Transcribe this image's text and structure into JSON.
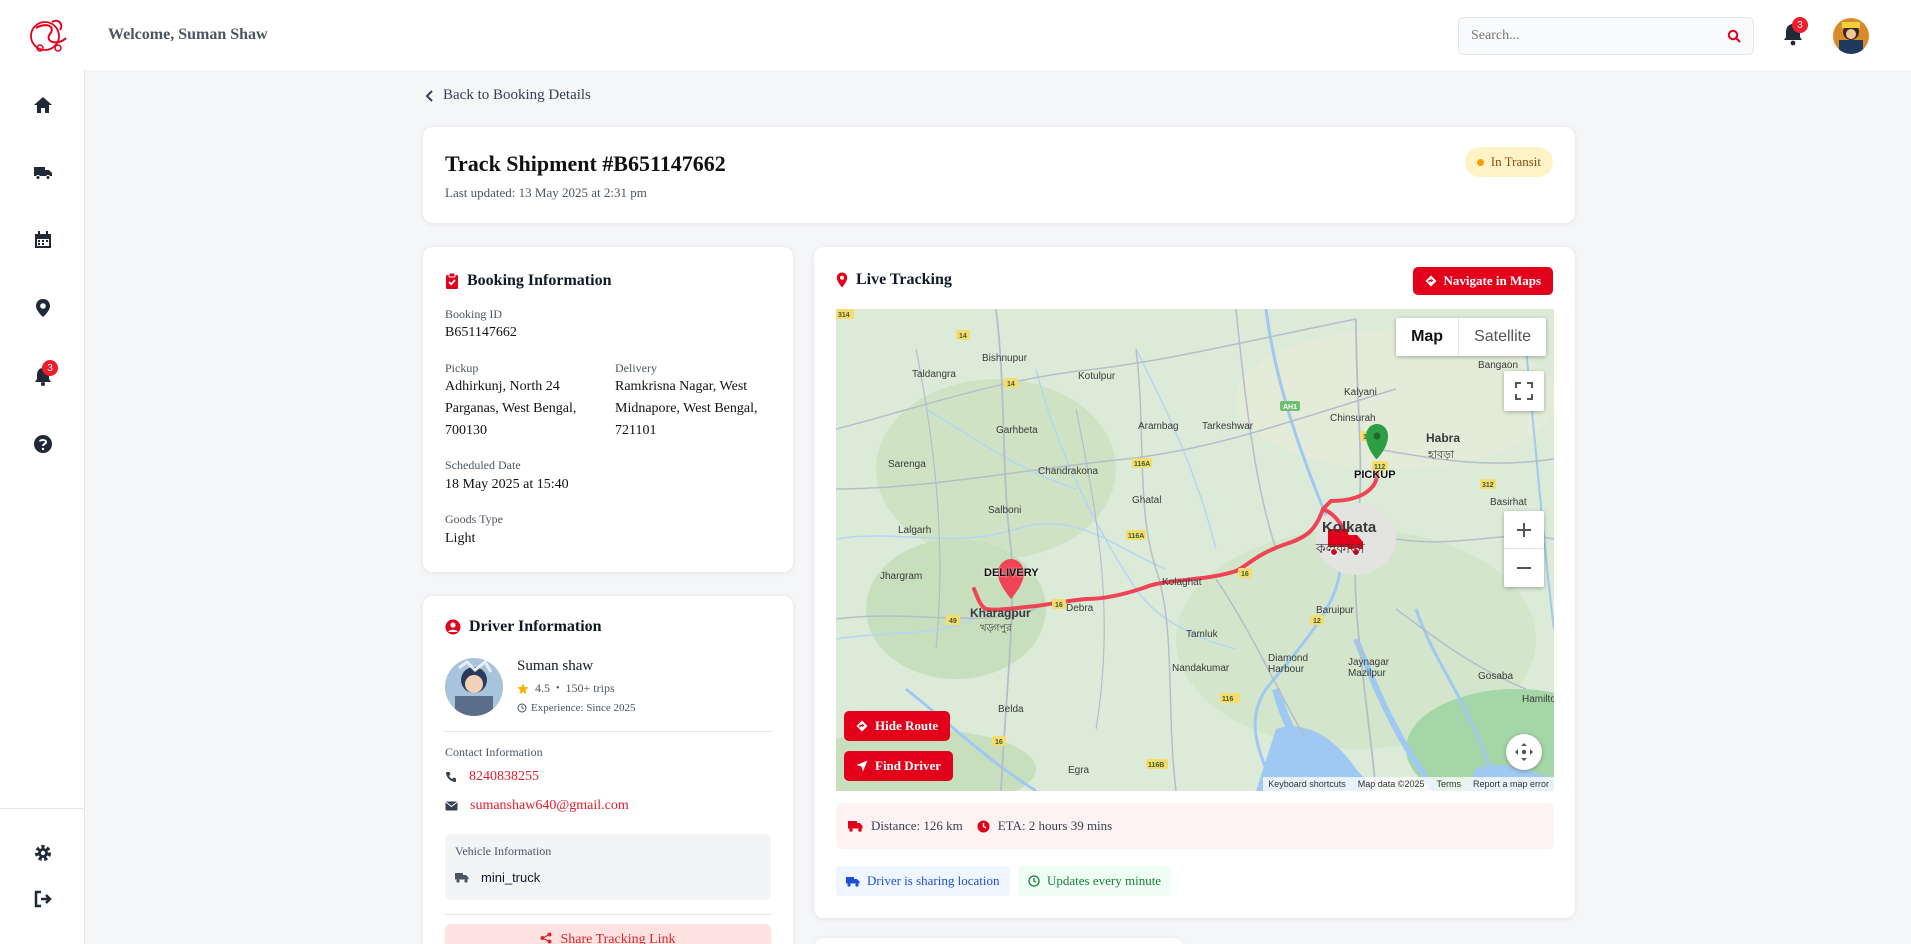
{
  "header": {
    "welcome": "Welcome, Suman Shaw",
    "search_placeholder": "Search...",
    "notification_count": "3"
  },
  "sidebar": {
    "items": [
      {
        "icon": "home-icon"
      },
      {
        "icon": "truck-icon"
      },
      {
        "icon": "calendar-icon"
      },
      {
        "icon": "location-pin-icon"
      },
      {
        "icon": "bell-icon",
        "badge": "3"
      },
      {
        "icon": "help-icon"
      },
      {
        "icon": "settings-icon"
      },
      {
        "icon": "logout-icon"
      }
    ]
  },
  "back_link": "Back to Booking Details",
  "shipment": {
    "title": "Track Shipment #B651147662",
    "last_updated": "Last updated: 13 May 2025 at 2:31 pm",
    "status": "In Transit"
  },
  "booking": {
    "title": "Booking Information",
    "booking_id_label": "Booking ID",
    "booking_id": "B651147662",
    "pickup_label": "Pickup",
    "pickup_line1": "Adhirkunj, North 24",
    "pickup_line2": "Parganas, West Bengal,",
    "pickup_line3": "700130",
    "delivery_label": "Delivery",
    "delivery_line1": "Ramkrisna Nagar, West",
    "delivery_line2": "Midnapore, West Bengal,",
    "delivery_line3": "721101",
    "scheduled_label": "Scheduled Date",
    "scheduled": "18 May 2025 at 15:40",
    "goods_label": "Goods Type",
    "goods": "Light"
  },
  "driver": {
    "title": "Driver Information",
    "name": "Suman shaw",
    "rating": "4.5",
    "trips": "150+ trips",
    "experience": "Experience: Since 2025",
    "contact_label": "Contact Information",
    "phone": "8240838255",
    "email": "sumanshaw640@gmail.com",
    "vehicle_label": "Vehicle Information",
    "vehicle": "mini_truck",
    "share_label": "Share Tracking Link"
  },
  "tracking": {
    "title": "Live Tracking",
    "navigate_label": "Navigate in Maps",
    "map_tab": "Map",
    "satellite_tab": "Satellite",
    "pickup_marker": "PICKUP",
    "delivery_marker": "DELIVERY",
    "hide_route": "Hide Route",
    "find_driver": "Find Driver",
    "attribution": {
      "shortcuts": "Keyboard shortcuts",
      "data": "Map data ©2025",
      "terms": "Terms",
      "report": "Report a map error"
    },
    "place_labels": {
      "kolkata": "Kolkata",
      "kolkata_bn": "কলকাতা",
      "kharagpur": "Kharagpur",
      "kharagpur_bn": "খড়্গপুর",
      "habra": "Habra",
      "habra_bn": "হাবড়া",
      "chinsurah": "Chinsurah",
      "kalyani": "Kalyani",
      "tarkeshwar": "Tarkeshwar",
      "arambag": "Arambag",
      "garhbeta": "Garhbeta",
      "chandrakona": "Chandrakona",
      "ghatal": "Ghatal",
      "salboni": "Salboni",
      "lalgarh": "Lalgarh",
      "jhargram": "Jhargram",
      "debra": "Debra",
      "kolaghat": "Kolaghat",
      "tamluk": "Tamluk",
      "nandakumar": "Nandakumar",
      "diamond_harbour": "Diamond Harbour",
      "baruipur": "Baruipur",
      "jaynagar": "Jaynagar Mazilpur",
      "gosaba": "Gosaba",
      "basirhat": "Basirhat",
      "bangaon": "Bangaon",
      "bishnupur": "Bishnupur",
      "kotulpur": "Kotulpur",
      "taldangra": "Taldangra",
      "sarenga": "Sarenga",
      "belda": "Belda",
      "egra": "Egra",
      "hamilton": "Hamilto"
    },
    "distance": "Distance: 126 km",
    "eta": "ETA: 2 hours 39 mins",
    "sharing": "Driver is sharing location",
    "updates": "Updates every minute"
  },
  "colors": {
    "brand_red": "#e3001b",
    "status_bg": "#fef3c7",
    "route": "#ef4455",
    "pickup_green": "#2e9e44"
  }
}
